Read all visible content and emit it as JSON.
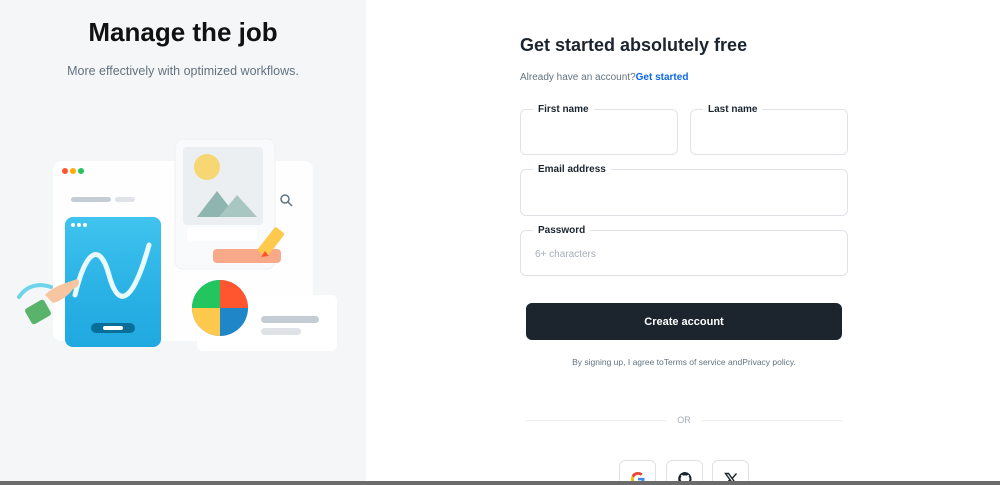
{
  "hero": {
    "title": "Manage the job",
    "subtitle": "More effectively with optimized workflows."
  },
  "form": {
    "title": "Get started absolutely free",
    "already_text": "Already have an account?",
    "signin_link": "Get started",
    "first_name": {
      "label": "First name",
      "value": "",
      "placeholder": ""
    },
    "last_name": {
      "label": "Last name",
      "value": "",
      "placeholder": ""
    },
    "email": {
      "label": "Email address",
      "value": "",
      "placeholder": ""
    },
    "password": {
      "label": "Password",
      "value": "",
      "placeholder": "6+ characters"
    },
    "submit_label": "Create account",
    "terms_prefix": "By signing up, I agree to",
    "terms_link": "Terms of service",
    "terms_and": " and",
    "privacy_link": "Privacy policy",
    "terms_suffix": ".",
    "divider": "OR"
  },
  "social": [
    {
      "name": "google-icon"
    },
    {
      "name": "github-icon"
    },
    {
      "name": "x-icon"
    }
  ],
  "colors": {
    "left_bg": "#f4f6f8",
    "button_bg": "#1c252e",
    "link": "#0c68e9"
  }
}
